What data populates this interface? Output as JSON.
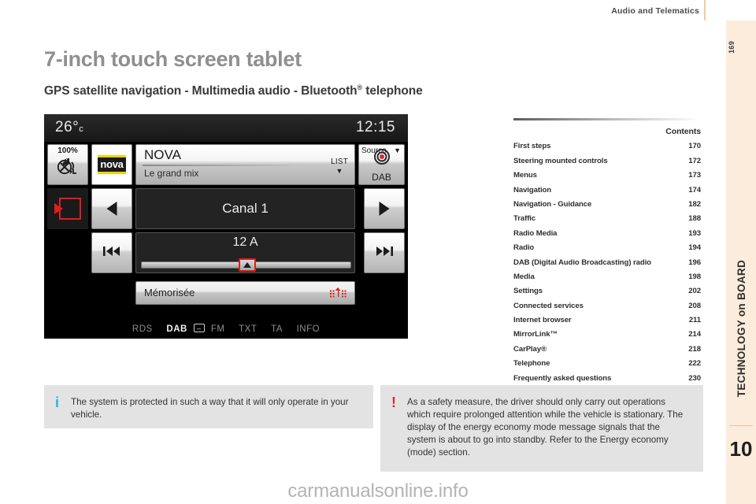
{
  "header": {
    "title": "Audio and Telematics"
  },
  "sidebar": {
    "page_number": "169",
    "section_label": "TECHNOLOGY on BOARD",
    "chapter_number": "10"
  },
  "page": {
    "title": "7-inch touch screen tablet",
    "subtitle_parts": {
      "main": "GPS satellite navigation - Multimedia audio - Bluetooth",
      "registered": "®",
      "tail": " telephone"
    }
  },
  "tablet": {
    "temperature": "26°",
    "temperature_unit": "c",
    "clock": "12:15",
    "mute_percent": "100%",
    "mute_icon": "mute-audio-icon",
    "station_logo": "nova",
    "station_name": "NOVA",
    "station_subtitle": "Le grand mix",
    "list_label": "LIST",
    "list_caret": "▼",
    "source_label": "Source",
    "source_caret": "▼",
    "source_value": "DAB",
    "back_icon": "back-exit-icon",
    "prev_arrow": "◀",
    "next_arrow": "▶",
    "channel_label": "Canal 1",
    "frequency_label": "12 A",
    "prev_track_icon": "⏮",
    "next_track_icon": "⏭",
    "cursor_icon": "slider-cursor-up",
    "memorised_label": "Mémorisée",
    "equalizer_icon": "signal-bars-icon",
    "status_items": [
      {
        "label": "RDS",
        "active": false
      },
      {
        "label": "DAB",
        "active": true
      },
      {
        "label": "FM",
        "active": false
      },
      {
        "label": "TXT",
        "active": false
      },
      {
        "label": "TA",
        "active": false
      },
      {
        "label": "INFO",
        "active": false
      }
    ],
    "dab_switch_glyph": "–"
  },
  "contents": {
    "title": "Contents",
    "rows": [
      {
        "label": "First steps",
        "page": "170"
      },
      {
        "label": "Steering mounted controls",
        "page": "172"
      },
      {
        "label": "Menus",
        "page": "173"
      },
      {
        "label": "Navigation",
        "page": "174"
      },
      {
        "label": "Navigation - Guidance",
        "page": "182"
      },
      {
        "label": "Traffic",
        "page": "188"
      },
      {
        "label": "Radio Media",
        "page": "193"
      },
      {
        "label": "Radio",
        "page": "194"
      },
      {
        "label": "DAB (Digital Audio Broadcasting) radio",
        "page": "196"
      },
      {
        "label": "Media",
        "page": "198"
      },
      {
        "label": "Settings",
        "page": "202"
      },
      {
        "label": "Connected services",
        "page": "208"
      },
      {
        "label": "Internet browser",
        "page": "211"
      },
      {
        "label": "MirrorLink™",
        "page": "214"
      },
      {
        "label": "CarPlay®",
        "page": "218"
      },
      {
        "label": "Telephone",
        "page": "222"
      },
      {
        "label": "Frequently asked questions",
        "page": "230"
      }
    ]
  },
  "notes": {
    "info": {
      "icon": "i",
      "text": "The system is protected in such a way that it will only operate in your vehicle."
    },
    "warning": {
      "icon": "!",
      "text": "As a safety measure, the driver should only carry out operations which require prolonged attention while the vehicle is stationary. The display of the energy economy mode message signals that the system is about to go into standby. Refer to the Energy economy (mode) section."
    }
  },
  "watermark": {
    "text": "carmanualsonline.info"
  }
}
